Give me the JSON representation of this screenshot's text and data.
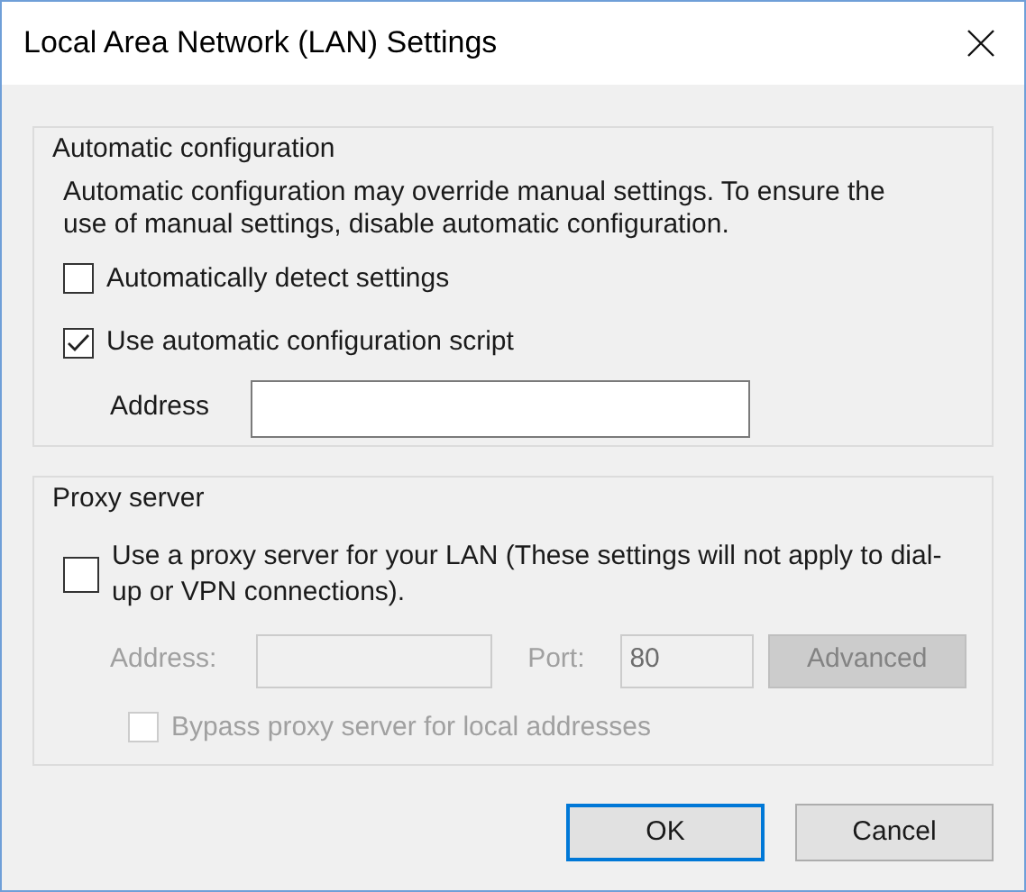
{
  "window": {
    "title": "Local Area Network (LAN) Settings"
  },
  "automatic_configuration": {
    "title": "Automatic configuration",
    "description": "Automatic configuration may override manual settings.  To ensure the use of manual settings, disable automatic configuration.",
    "options": [
      {
        "label": "Automatically detect settings",
        "checked": false,
        "disabled": false
      },
      {
        "label": "Use automatic configuration script",
        "checked": true,
        "disabled": false
      }
    ],
    "address": {
      "label": "Address",
      "disabled": false
    }
  },
  "proxy_server": {
    "title": "Proxy server",
    "use_proxy": {
      "label": "Use a proxy server for your LAN (These settings will not apply to dial-up or VPN connections).",
      "checked": false,
      "disabled": false
    },
    "address": {
      "label": "Address:",
      "disabled": true
    },
    "port": {
      "label": "Port:",
      "value": "80",
      "disabled": true
    },
    "advanced_button": {
      "label": "Advanced",
      "disabled": true
    },
    "bypass": {
      "label": "Bypass proxy server for local addresses",
      "checked": false,
      "disabled": true
    }
  },
  "buttons": [
    {
      "label": "OK",
      "default": true
    },
    {
      "label": "Cancel",
      "default": false
    }
  ]
}
